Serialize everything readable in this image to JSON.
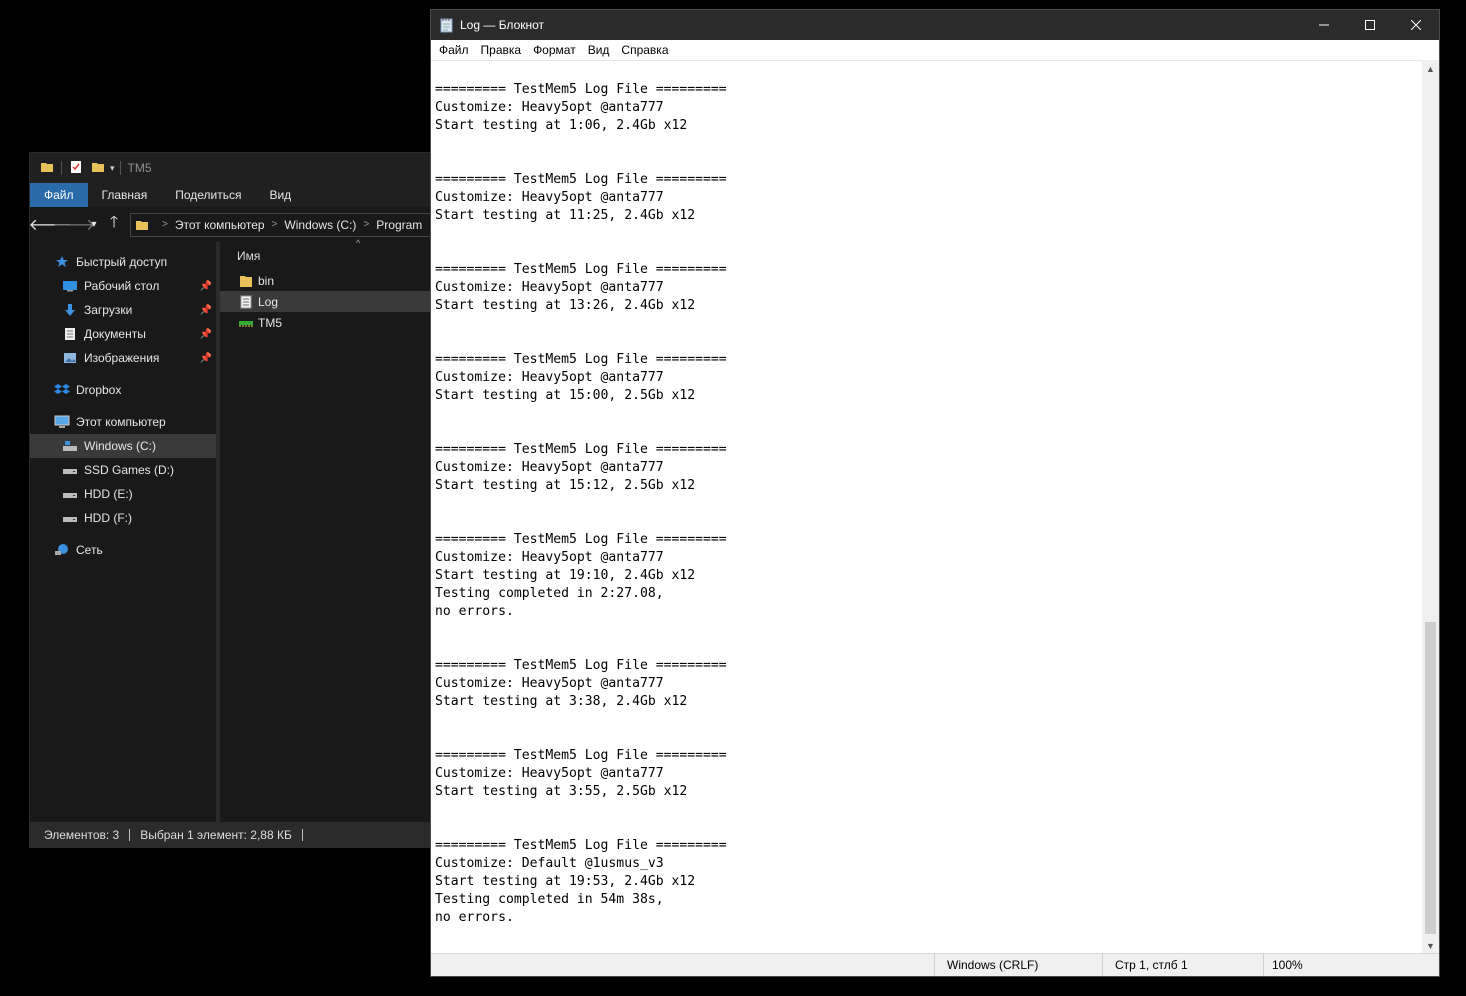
{
  "explorer": {
    "title": "TM5",
    "ribbon_tabs": [
      "Файл",
      "Главная",
      "Поделиться",
      "Вид"
    ],
    "address": [
      "Этот компьютер",
      "Windows (C:)",
      "Program"
    ],
    "sidebar": {
      "quick_access": "Быстрый доступ",
      "quick_items": [
        "Рабочий стол",
        "Загрузки",
        "Документы",
        "Изображения"
      ],
      "dropbox": "Dropbox",
      "this_pc": "Этот компьютер",
      "drives": [
        "Windows (C:)",
        "SSD Games (D:)",
        "HDD (E:)",
        "HDD (F:)"
      ],
      "network": "Сеть"
    },
    "column_header": "Имя",
    "files": [
      {
        "name": "bin",
        "icon": "folder-icon"
      },
      {
        "name": "Log",
        "icon": "text-file-icon"
      },
      {
        "name": "TM5",
        "icon": "app-icon"
      }
    ],
    "status": {
      "items": "Элементов: 3",
      "selected": "Выбран 1 элемент: 2,88 КБ"
    }
  },
  "notepad": {
    "title": "Log — Блокнот",
    "menu": [
      "Файл",
      "Правка",
      "Формат",
      "Вид",
      "Справка"
    ],
    "content": "========= TestMem5 Log File =========\nCustomize: Heavy5opt @anta777\nStart testing at 1:06, 2.4Gb x12\n\n\n========= TestMem5 Log File =========\nCustomize: Heavy5opt @anta777\nStart testing at 11:25, 2.4Gb x12\n\n\n========= TestMem5 Log File =========\nCustomize: Heavy5opt @anta777\nStart testing at 13:26, 2.4Gb x12\n\n\n========= TestMem5 Log File =========\nCustomize: Heavy5opt @anta777\nStart testing at 15:00, 2.5Gb x12\n\n\n========= TestMem5 Log File =========\nCustomize: Heavy5opt @anta777\nStart testing at 15:12, 2.5Gb x12\n\n\n========= TestMem5 Log File =========\nCustomize: Heavy5opt @anta777\nStart testing at 19:10, 2.4Gb x12\nTesting completed in 2:27.08,\nno errors.\n\n\n========= TestMem5 Log File =========\nCustomize: Heavy5opt @anta777\nStart testing at 3:38, 2.4Gb x12\n\n\n========= TestMem5 Log File =========\nCustomize: Heavy5opt @anta777\nStart testing at 3:55, 2.5Gb x12\n\n\n========= TestMem5 Log File =========\nCustomize: Default @1usmus_v3\nStart testing at 19:53, 2.4Gb x12\nTesting completed in 54m 38s,\nno errors.",
    "status": {
      "encoding": "Windows (CRLF)",
      "position": "Стр 1, стлб 1",
      "zoom": "100%"
    }
  },
  "colors": {
    "explorer_bg": "#191919",
    "ribbon_active": "#2b6aa8",
    "notepad_title_bg": "#2b2b2b"
  }
}
